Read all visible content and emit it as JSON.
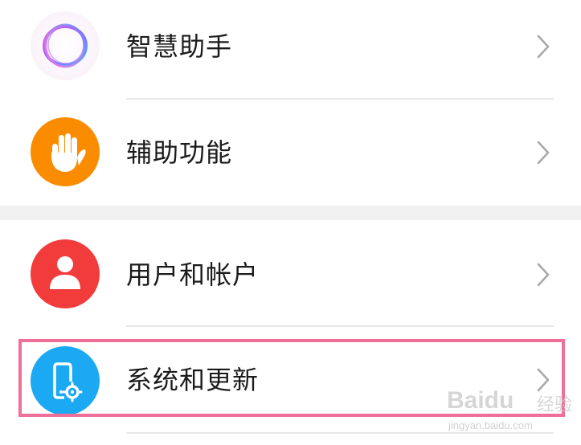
{
  "settings": {
    "items": [
      {
        "label": "智慧助手",
        "icon": "assistant-ring-icon",
        "color": "#ffffff"
      },
      {
        "label": "辅助功能",
        "icon": "hand-icon",
        "color": "#fb8c00"
      },
      {
        "label": "用户和帐户",
        "icon": "person-icon",
        "color": "#f23b3b"
      },
      {
        "label": "系统和更新",
        "icon": "phone-gear-icon",
        "color": "#1aa9f2"
      }
    ],
    "chevron_icon": "chevron-right-icon",
    "highlight_color": "#ee6f98"
  },
  "watermark": {
    "brand": "Baidu",
    "brand_cn": "经验",
    "url": "jingyan.baidu.com"
  }
}
